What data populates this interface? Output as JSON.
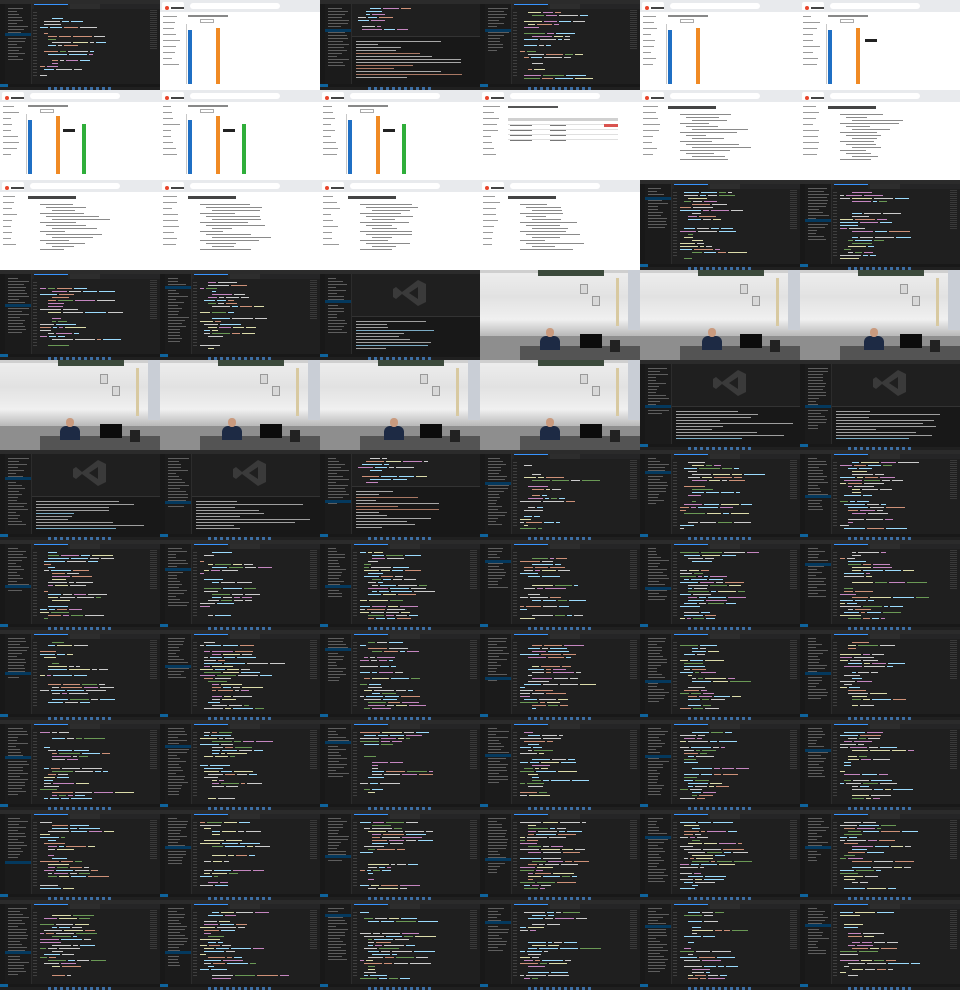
{
  "sheet": {
    "columns": 6,
    "rows": 11,
    "tiles": [
      {
        "kind": "code"
      },
      {
        "kind": "chart",
        "bars": [
          "blue",
          "orange"
        ]
      },
      {
        "kind": "term"
      },
      {
        "kind": "code"
      },
      {
        "kind": "chart",
        "bars": [
          "blue",
          "orange"
        ]
      },
      {
        "kind": "chart",
        "bars": [
          "blue",
          "orange"
        ],
        "tooltip": true
      },
      {
        "kind": "chart",
        "bars": [
          "blue",
          "orange",
          "green"
        ],
        "tooltip": true
      },
      {
        "kind": "chart",
        "bars": [
          "blue",
          "orange",
          "green"
        ],
        "tooltip": true
      },
      {
        "kind": "chart",
        "bars": [
          "blue",
          "orange",
          "green"
        ],
        "tooltip": true
      },
      {
        "kind": "table"
      },
      {
        "kind": "text"
      },
      {
        "kind": "text"
      },
      {
        "kind": "text"
      },
      {
        "kind": "text"
      },
      {
        "kind": "text"
      },
      {
        "kind": "text"
      },
      {
        "kind": "code"
      },
      {
        "kind": "code"
      },
      {
        "kind": "code"
      },
      {
        "kind": "code"
      },
      {
        "kind": "logo"
      },
      {
        "kind": "cam"
      },
      {
        "kind": "cam"
      },
      {
        "kind": "cam"
      },
      {
        "kind": "cam"
      },
      {
        "kind": "cam"
      },
      {
        "kind": "cam"
      },
      {
        "kind": "cam"
      },
      {
        "kind": "logo"
      },
      {
        "kind": "logo"
      },
      {
        "kind": "logo"
      },
      {
        "kind": "logo"
      },
      {
        "kind": "term"
      },
      {
        "kind": "code"
      },
      {
        "kind": "code"
      },
      {
        "kind": "code"
      },
      {
        "kind": "code"
      },
      {
        "kind": "code"
      },
      {
        "kind": "code"
      },
      {
        "kind": "code"
      },
      {
        "kind": "code"
      },
      {
        "kind": "code"
      },
      {
        "kind": "code"
      },
      {
        "kind": "code"
      },
      {
        "kind": "code"
      },
      {
        "kind": "code"
      },
      {
        "kind": "code"
      },
      {
        "kind": "code"
      },
      {
        "kind": "code"
      },
      {
        "kind": "code"
      },
      {
        "kind": "code"
      },
      {
        "kind": "code"
      },
      {
        "kind": "code"
      },
      {
        "kind": "code"
      },
      {
        "kind": "code"
      },
      {
        "kind": "code"
      },
      {
        "kind": "code"
      },
      {
        "kind": "code"
      },
      {
        "kind": "code"
      },
      {
        "kind": "code"
      },
      {
        "kind": "code"
      },
      {
        "kind": "code"
      },
      {
        "kind": "code"
      },
      {
        "kind": "code"
      },
      {
        "kind": "code"
      },
      {
        "kind": "code"
      }
    ]
  },
  "colors": {
    "editor_bg": "#1f1f1f",
    "accent_blue": "#3794ff",
    "bar_blue": "#1f6fc4",
    "bar_orange": "#f08a24",
    "bar_green": "#2fae3a",
    "keyword": "#c586c0",
    "string": "#ce9178",
    "function": "#dcdcaa",
    "variable": "#9cdcfe",
    "plain": "#cccccc",
    "comment": "#6a9955"
  },
  "icons": {
    "editor_logo": "vscode-logo-icon",
    "favicon": "site-favicon-icon"
  }
}
